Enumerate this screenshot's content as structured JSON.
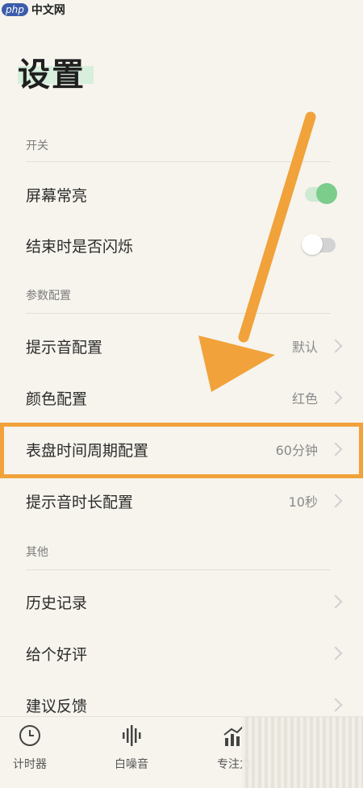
{
  "watermark": {
    "logo": "php",
    "site": "中文网"
  },
  "page_title": "设置",
  "sections": [
    {
      "title": "开关"
    },
    {
      "title": "参数配置"
    },
    {
      "title": "其他"
    }
  ],
  "switch_items": [
    {
      "label": "屏幕常亮",
      "state": "on"
    },
    {
      "label": "结束时是否闪烁",
      "state": "off"
    }
  ],
  "param_items": [
    {
      "label": "提示音配置",
      "value": "默认"
    },
    {
      "label": "颜色配置",
      "value": "红色"
    },
    {
      "label": "表盘时间周期配置",
      "value": "60分钟"
    },
    {
      "label": "提示音时长配置",
      "value": "10秒"
    }
  ],
  "other_items": [
    {
      "label": "历史记录"
    },
    {
      "label": "给个好评"
    },
    {
      "label": "建议反馈"
    }
  ],
  "tabs": [
    {
      "label": "计时器",
      "icon": "clock-icon"
    },
    {
      "label": "白噪音",
      "icon": "soundwave-icon"
    },
    {
      "label": "专注力",
      "icon": "chart-icon"
    }
  ],
  "colors": {
    "accent_green": "#7ccc8c",
    "annotation_orange": "#f1a23a",
    "background": "#f6f4ed"
  }
}
